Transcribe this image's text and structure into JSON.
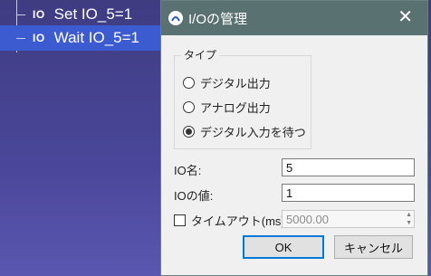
{
  "tree": {
    "items": [
      {
        "tag": "IO",
        "label": "Set IO_5=1"
      },
      {
        "tag": "IO",
        "label": "Wait IO_5=1"
      }
    ]
  },
  "dialog": {
    "title": "I/Oの管理",
    "type_group_label": "タイプ",
    "radios": [
      {
        "label": "デジタル出力",
        "checked": false
      },
      {
        "label": "アナログ出力",
        "checked": false
      },
      {
        "label": "デジタル入力を待つ",
        "checked": true
      }
    ],
    "io_name_label": "IO名:",
    "io_name_value": "5",
    "io_value_label": "IOの値:",
    "io_value_value": "1",
    "timeout_label": "タイムアウト(ms)",
    "timeout_checked": false,
    "timeout_value": "5000.00",
    "ok_label": "OK",
    "cancel_label": "キャンセル"
  },
  "colors": {
    "titlebar": "#5a7171",
    "selection": "#3c5bd0",
    "background": "#4a479a"
  },
  "icons": [
    "close-icon",
    "app-icon",
    "spin-up-icon",
    "spin-down-icon"
  ]
}
